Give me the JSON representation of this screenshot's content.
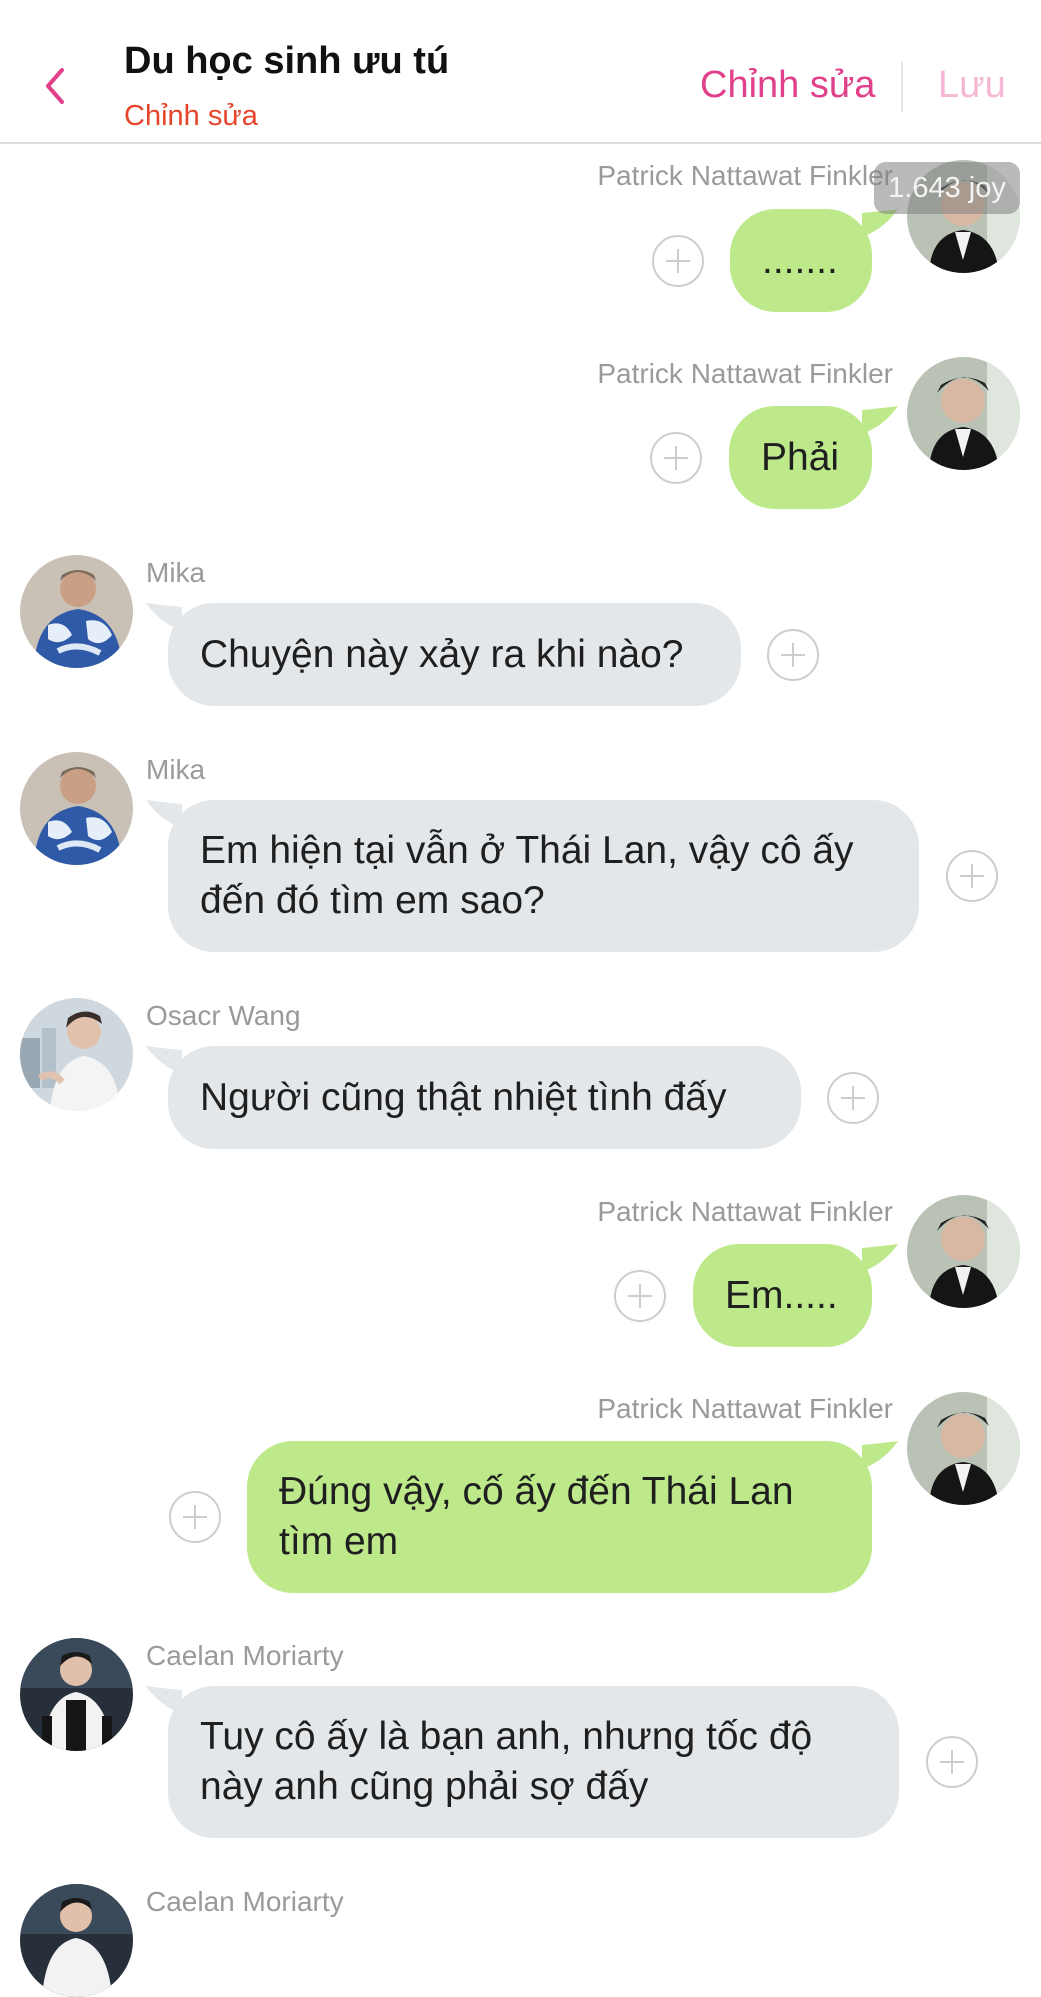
{
  "header": {
    "title": "Du học sinh ưu tú",
    "subtitle": "Chỉnh sửa",
    "edit_label": "Chỉnh sửa",
    "save_label": "Lưu"
  },
  "joy_badge": "1.643 joy",
  "messages": [
    {
      "sender": "Patrick Nattawat Finkler",
      "text": "......."
    },
    {
      "sender": "Patrick Nattawat Finkler",
      "text": "Phải"
    },
    {
      "sender": "Mika",
      "text": "Chuyện này xảy ra khi nào?"
    },
    {
      "sender": "Mika",
      "text": "Em hiện tại vẫn ở Thái Lan, vậy cô ấy đến đó tìm em sao?"
    },
    {
      "sender": "Osacr Wang",
      "text": "Người cũng thật nhiệt tình đấy"
    },
    {
      "sender": "Patrick Nattawat Finkler",
      "text": "Em....."
    },
    {
      "sender": "Patrick Nattawat Finkler",
      "text": "Đúng vậy, cố ấy đến Thái Lan tìm em"
    },
    {
      "sender": "Caelan Moriarty",
      "text": "Tuy cô ấy là bạn anh, nhưng tốc độ này anh cũng phải sợ đấy"
    },
    {
      "sender": "Caelan Moriarty",
      "text": ""
    }
  ],
  "colors": {
    "accent_pink": "#e0418a",
    "save_pink": "#f5b8d3",
    "subtitle_orange": "#e6452c",
    "bubble_right": "#bde98a",
    "bubble_left": "#e4e7ea"
  }
}
